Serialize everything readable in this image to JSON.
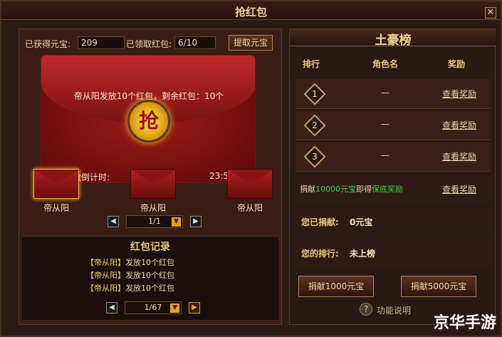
{
  "window": {
    "title": "抢红包",
    "close": "✕"
  },
  "left": {
    "obtained_label": "已获得元宝:",
    "obtained_value": "209",
    "claimed_label": "已领取红包:",
    "claimed_value": "6/10",
    "withdraw_button": "提取元宝",
    "envelope": {
      "message": "帝从阳发放10个红包，剩余红包：10个",
      "grab_label": "抢",
      "timer_label": "红包有效倒计时:",
      "timer_value": "23:59:04"
    },
    "small_envelopes": [
      "帝从阳",
      "帝从阳",
      "帝从阳"
    ],
    "pager": {
      "prev": "◀",
      "value": "1/1",
      "dd": "▼",
      "next": "▶"
    },
    "records": {
      "title": "红包记录",
      "rows": [
        {
          "name": "【帝从阳】",
          "text": "发放10个红包"
        },
        {
          "name": "【帝从阳】",
          "text": "发放10个红包"
        },
        {
          "name": "【帝从阳】",
          "text": "发放10个红包"
        }
      ],
      "pager": {
        "prev": "◀",
        "value": "1/67",
        "dd": "▼",
        "next": "▶"
      }
    }
  },
  "right": {
    "title": "土豪榜",
    "columns": [
      "排行",
      "角色名",
      "奖励"
    ],
    "rows": [
      {
        "rank": "1",
        "name": "—",
        "reward": "查看奖励"
      },
      {
        "rank": "2",
        "name": "—",
        "reward": "查看奖励"
      },
      {
        "rank": "3",
        "name": "—",
        "reward": "查看奖励"
      }
    ],
    "donate_note_prefix": "捐献",
    "donate_note_amount": "10000元宝",
    "donate_note_mid": "即得",
    "donate_note_reward": "保底奖励",
    "donate_note_link": "查看奖励",
    "donated_label": "您已捐献:",
    "donated_value": "0元宝",
    "rank_label": "您的排行:",
    "rank_value": "未上榜",
    "donate_1000": "捐献1000元宝",
    "donate_5000": "捐献5000元宝",
    "help": "功能说明"
  },
  "watermark": "京华手游",
  "colors": {
    "accent_gold": "#e8c880",
    "envelope_red": "#a01818",
    "green": "#40d040"
  }
}
